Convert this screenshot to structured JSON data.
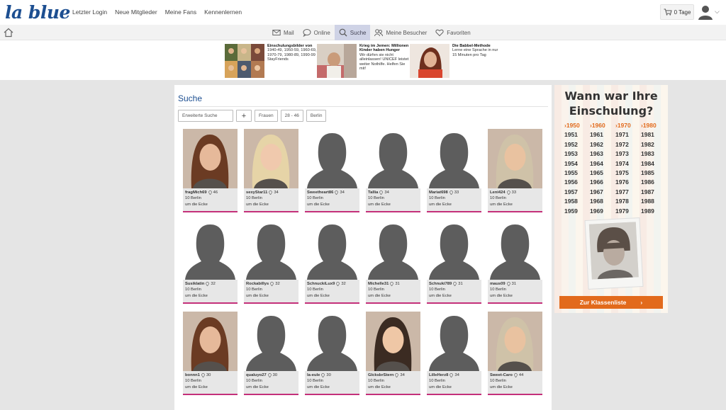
{
  "app": {
    "logo": "la blue"
  },
  "topnav": [
    "Letzter Login",
    "Neue Mitglieder",
    "Meine Fans",
    "Kennenlernen"
  ],
  "account": {
    "days": "0 Tage"
  },
  "subnav": [
    {
      "label": "Mail",
      "icon": "mail-icon",
      "active": false
    },
    {
      "label": "Online",
      "icon": "chat-bubble-icon",
      "active": false
    },
    {
      "label": "Suche",
      "icon": "search-icon",
      "active": true
    },
    {
      "label": "Meine Besucher",
      "icon": "visitors-icon",
      "active": false
    },
    {
      "label": "Favoriten",
      "icon": "heart-icon",
      "active": false
    }
  ],
  "ads": [
    {
      "title": "Einschulungsbilder von",
      "body": "1940-49, 1950-59, 1960-69, 1970-79, 1980-89, 1990-99 StayFriends"
    },
    {
      "title": "Krieg im Jemen: Millionen Kinder haben Hunger",
      "body": "Wir dürfen sie nicht alleinlassen! UNICEF leistet weiter Nothilfe. Helfen Sie mit!"
    },
    {
      "title": "Die Babbel-Methode",
      "body": "Lerne eine Sprache in nur 15 Minuten pro Tag"
    }
  ],
  "search": {
    "title": "Suche",
    "advanced_label": "Erweiterte Suche",
    "plus_label": "+",
    "filters": [
      "Frauen",
      "28 - 46",
      "Berlin"
    ]
  },
  "profiles": [
    {
      "name": "fragMich69",
      "age": "46",
      "distance": "10 Berlin",
      "note": "um die Ecke",
      "photo": "photo"
    },
    {
      "name": "sexyStar11",
      "age": "34",
      "distance": "10 Berlin",
      "note": "um die Ecke",
      "photo": "photo"
    },
    {
      "name": "Sweetheart86",
      "age": "34",
      "distance": "10 Berlin",
      "note": "um die Ecke",
      "photo": "silhouette"
    },
    {
      "name": "Tallia",
      "age": "34",
      "distance": "10 Berlin",
      "note": "um die Ecke",
      "photo": "silhouette"
    },
    {
      "name": "Mariat698",
      "age": "33",
      "distance": "10 Berlin",
      "note": "um die Ecke",
      "photo": "silhouette"
    },
    {
      "name": "Leni424",
      "age": "33",
      "distance": "10 Berlin",
      "note": "um die Ecke",
      "photo": "photo"
    },
    {
      "name": "Susiklatin",
      "age": "32",
      "distance": "10 Berlin",
      "note": "um die Ecke",
      "photo": "silhouette"
    },
    {
      "name": "Rockabillys",
      "age": "32",
      "distance": "10 Berlin",
      "note": "um die Ecke",
      "photo": "silhouette"
    },
    {
      "name": "SchnuckiLux9",
      "age": "32",
      "distance": "10 Berlin",
      "note": "um die Ecke",
      "photo": "silhouette"
    },
    {
      "name": "Michelle31",
      "age": "31",
      "distance": "10 Berlin",
      "note": "um die Ecke",
      "photo": "silhouette"
    },
    {
      "name": "Schnuki789",
      "age": "31",
      "distance": "10 Berlin",
      "note": "um die Ecke",
      "photo": "silhouette"
    },
    {
      "name": "maus09",
      "age": "31",
      "distance": "10 Berlin",
      "note": "um die Ecke",
      "photo": "silhouette"
    },
    {
      "name": "bonnn1",
      "age": "30",
      "distance": "10 Berlin",
      "note": "um die Ecke",
      "photo": "photo"
    },
    {
      "name": "qualuyo27",
      "age": "30",
      "distance": "10 Berlin",
      "note": "um die Ecke",
      "photo": "silhouette"
    },
    {
      "name": "la-eule",
      "age": "30",
      "distance": "10 Berlin",
      "note": "um die Ecke",
      "photo": "silhouette"
    },
    {
      "name": "GlcksbrStern",
      "age": "34",
      "distance": "10 Berlin",
      "note": "um die Ecke",
      "photo": "photo"
    },
    {
      "name": "LilleHerz8",
      "age": "34",
      "distance": "10 Berlin",
      "note": "um die Ecke",
      "photo": "silhouette"
    },
    {
      "name": "Sweet-Caro",
      "age": "44",
      "distance": "10 Berlin",
      "note": "um die Ecke",
      "photo": "photo"
    }
  ],
  "sidead": {
    "question": "Wann war Ihre Einschulung?",
    "years": [
      [
        "›1950",
        "›1960",
        "›1970",
        "›1980"
      ],
      [
        "1951",
        "1961",
        "1971",
        "1981"
      ],
      [
        "1952",
        "1962",
        "1972",
        "1982"
      ],
      [
        "1953",
        "1963",
        "1973",
        "1983"
      ],
      [
        "1954",
        "1964",
        "1974",
        "1984"
      ],
      [
        "1955",
        "1965",
        "1975",
        "1985"
      ],
      [
        "1956",
        "1966",
        "1976",
        "1986"
      ],
      [
        "1957",
        "1967",
        "1977",
        "1987"
      ],
      [
        "1958",
        "1968",
        "1978",
        "1988"
      ],
      [
        "1959",
        "1969",
        "1979",
        "1989"
      ]
    ],
    "cta": "Zur Klassenliste",
    "cta_arrow": "›"
  },
  "colors": {
    "brand": "#1d4f91",
    "accent": "#c4307a",
    "cta": "#e26a1c"
  }
}
